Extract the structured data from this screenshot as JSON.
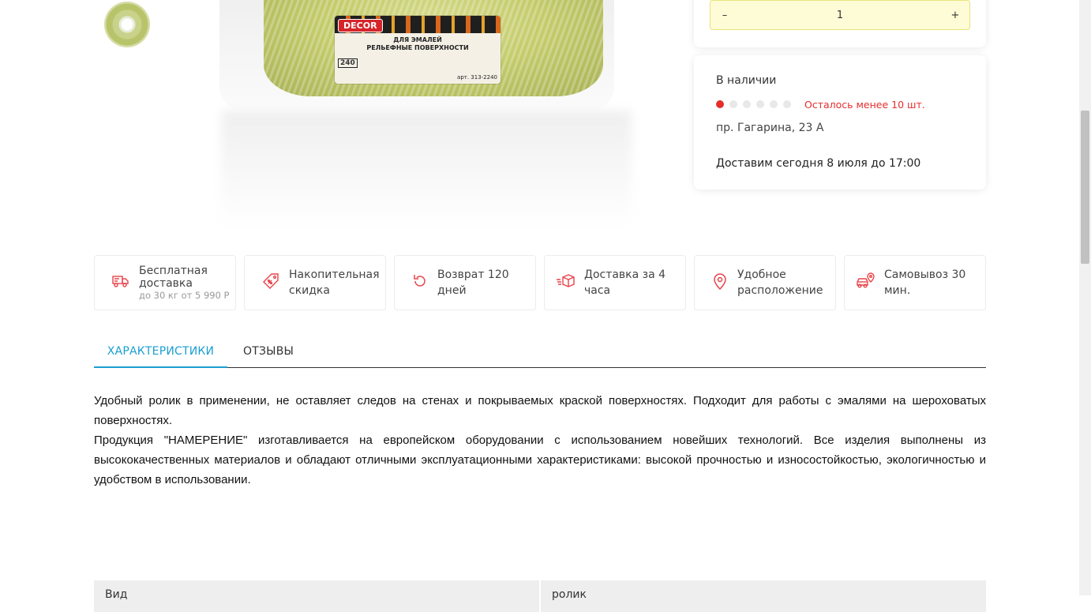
{
  "gallery": {
    "label_brand": "DECOR",
    "label_title_1": "ДЛЯ ЭМАЛЕЙ",
    "label_title_2": "РЕЛЬЕФНЫЕ ПОВЕРХНОСТИ",
    "label_size": "240",
    "label_code": "арт. 313-2240"
  },
  "quantity": {
    "minus": "–",
    "value": "1",
    "plus": "+"
  },
  "stock": {
    "title": "В наличии",
    "level_filled": 1,
    "level_total": 6,
    "warning": "Осталось менее 10 шт.",
    "address": "пр. Гагарина, 23 А",
    "delivery": "Доставим сегодня 8 июля до 17:00",
    "warning_color": "#e62e2e"
  },
  "features": [
    {
      "icon": "truck-icon",
      "title": "Бесплатная доставка",
      "subtitle": "до 30 кг от 5 990 Р"
    },
    {
      "icon": "discount-tag-icon",
      "title": "Накопительная скидка"
    },
    {
      "icon": "return-arrow-icon",
      "title": "Возврат 120 дней"
    },
    {
      "icon": "fast-box-icon",
      "title": "Доставка за 4 часа"
    },
    {
      "icon": "map-pin-icon",
      "title": "Удобное расположение"
    },
    {
      "icon": "car-pin-icon",
      "title": "Самовывоз 30 мин."
    }
  ],
  "tabs": [
    {
      "label": "ХАРАКТЕРИСТИКИ",
      "active": true
    },
    {
      "label": "ОТЗЫВЫ",
      "active": false
    }
  ],
  "description": {
    "p1": "Удобный ролик в применении, не оставляет следов на стенах и покрываемых краской поверхностях. Подходит для работы с эмалями на шероховатых поверхностях.",
    "p2": "Продукция \"НАМЕРЕНИЕ\" изготавливается на европейском оборудовании с использованием новейших технологий. Все изделия выполнены из высококачественных материалов и обладают отличными эксплуатационными характеристиками: высокой прочностью и износостойкостью, экологичностью и удобством в использовании."
  },
  "specs": [
    {
      "name": "Вид",
      "value": "ролик"
    }
  ],
  "colors": {
    "accent": "#1a9fd0",
    "icon_red": "#e8434a",
    "qty_bg": "#fefcd6"
  }
}
